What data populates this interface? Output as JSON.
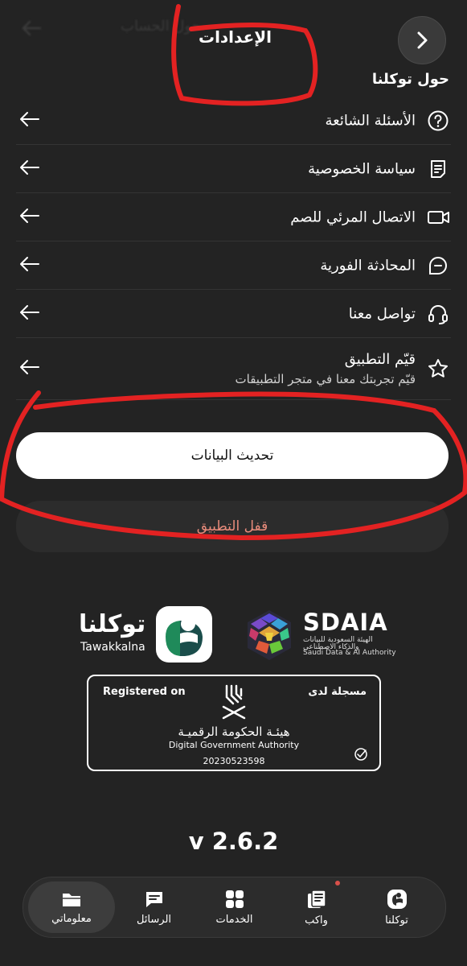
{
  "header": {
    "background_title": "حول الحساب",
    "title": "الإعدادات",
    "back_icon": "chevron-right-icon"
  },
  "section_title": "حول توكلنا",
  "menu": [
    {
      "label": "الأسئلة الشائعة",
      "icon": "question-icon"
    },
    {
      "label": "سياسة الخصوصية",
      "icon": "document-icon"
    },
    {
      "label": "الاتصال المرئي للصم",
      "icon": "video-icon"
    },
    {
      "label": "المحادثة الفورية",
      "icon": "chat-icon"
    },
    {
      "label": "تواصل معنا",
      "icon": "headset-icon"
    },
    {
      "label": "قيّم التطبيق",
      "sublabel": "قيّم تجربتك معنا في متجر التطبيقات",
      "icon": "star-icon"
    }
  ],
  "buttons": {
    "refresh": "تحديث البيانات",
    "lock": "قفل التطبيق"
  },
  "logos": {
    "tawakkalna_ar": "توكلنا",
    "tawakkalna_en": "Tawakkalna",
    "sdaia_name": "SDAIA",
    "sdaia_ar_line1": "الهيئة السعودية للبيانات",
    "sdaia_ar_line2": "والذكاء الاصطناعي",
    "sdaia_en": "Saudi Data & AI Authority"
  },
  "registration": {
    "registered_en": "Registered on",
    "registered_ar": "مسجلة لدى",
    "authority_ar": "هيئـة الحكومة الرقميـة",
    "authority_en": "Digital Government Authority",
    "number": "20230523598"
  },
  "version": "v 2.6.2",
  "nav": [
    {
      "label": "معلوماتي",
      "icon": "folder-icon",
      "active": true
    },
    {
      "label": "الرسائل",
      "icon": "message-icon",
      "active": false
    },
    {
      "label": "الخدمات",
      "icon": "grid-icon",
      "active": false
    },
    {
      "label": "واكب",
      "icon": "news-icon",
      "active": false,
      "badge": true
    },
    {
      "label": "توكلنا",
      "icon": "tawakkalna-icon",
      "active": false
    }
  ],
  "colors": {
    "background": "#232323",
    "annotation": "#e32222",
    "lock_text": "#e98b7b",
    "badge": "#d8504a"
  }
}
